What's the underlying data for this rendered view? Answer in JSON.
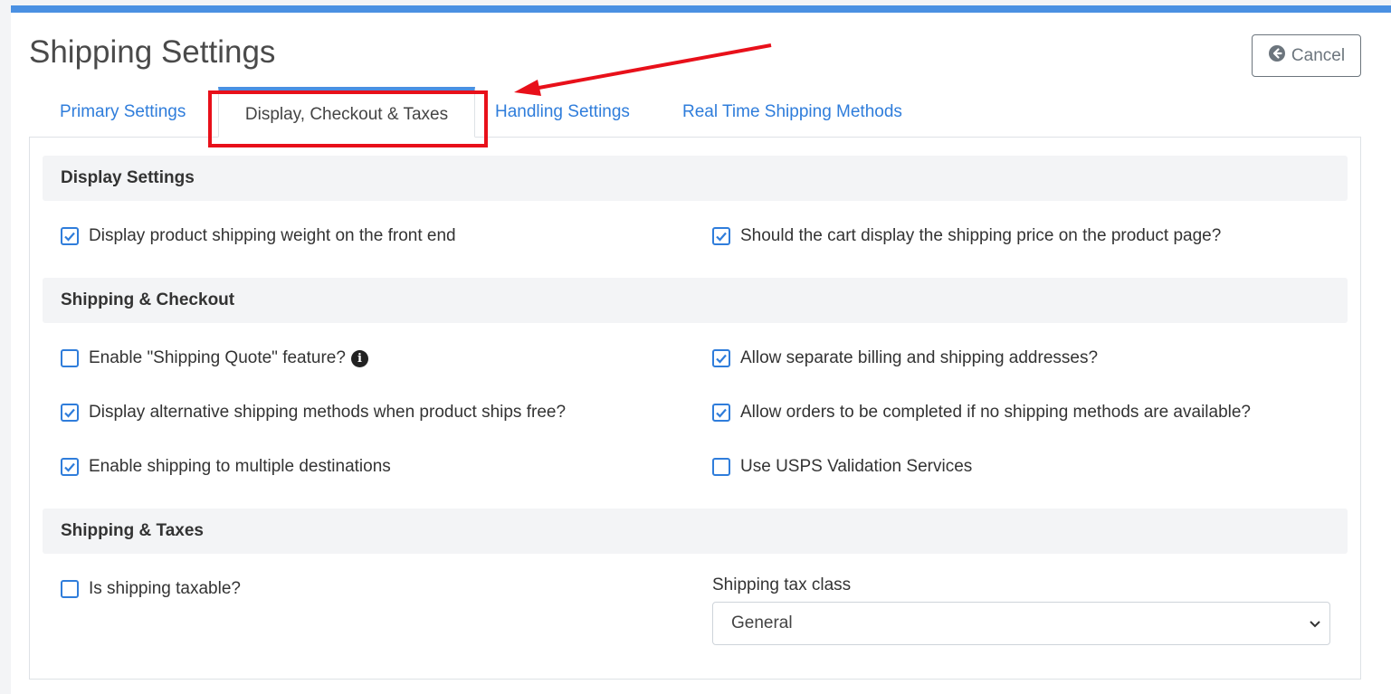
{
  "page": {
    "title": "Shipping Settings",
    "cancel_label": "Cancel"
  },
  "tabs": [
    {
      "label": "Primary Settings",
      "active": false
    },
    {
      "label": "Display, Checkout & Taxes",
      "active": true
    },
    {
      "label": "Handling Settings",
      "active": false
    },
    {
      "label": "Real Time Shipping Methods",
      "active": false
    }
  ],
  "sections": {
    "display": {
      "title": "Display Settings",
      "items": [
        {
          "label": "Display product shipping weight on the front end",
          "checked": true
        },
        {
          "label": "Should the cart display the shipping price on the product page?",
          "checked": true
        }
      ]
    },
    "checkout": {
      "title": "Shipping & Checkout",
      "items": [
        {
          "label": "Enable \"Shipping Quote\" feature?",
          "checked": false
        },
        {
          "label": "Allow separate billing and shipping addresses?",
          "checked": true
        },
        {
          "label": "Display alternative shipping methods when product ships free?",
          "checked": true
        },
        {
          "label": "Allow orders to be completed if no shipping methods are available?",
          "checked": true
        },
        {
          "label": "Enable shipping to multiple destinations",
          "checked": true
        },
        {
          "label": "Use USPS Validation Services",
          "checked": false
        }
      ]
    },
    "taxes": {
      "title": "Shipping & Taxes",
      "taxable": {
        "label": "Is shipping taxable?",
        "checked": false
      },
      "tax_class": {
        "label": "Shipping tax class",
        "value": "General"
      }
    }
  },
  "colors": {
    "accent": "#4a90e2",
    "link": "#2f7ddb",
    "annotation": "#e8101a"
  }
}
